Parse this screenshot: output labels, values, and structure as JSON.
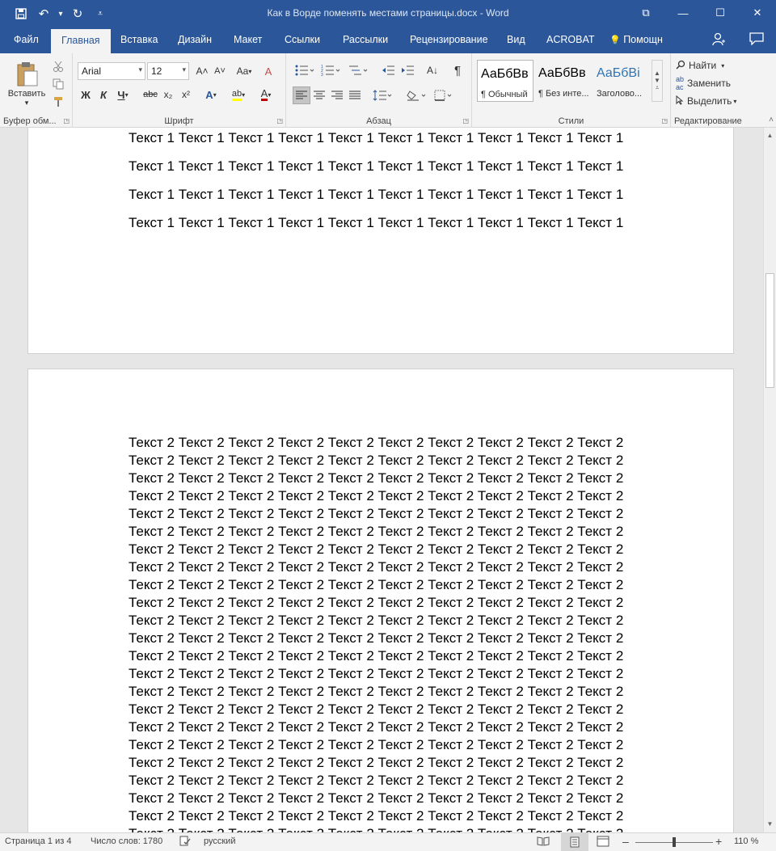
{
  "window": {
    "title": "Как в Ворде поменять местами страницы.docx - Word",
    "controls": {
      "ribbon_display": "⧉",
      "minimize": "—",
      "maximize": "☐",
      "close": "✕"
    }
  },
  "qat": {
    "save": "💾",
    "undo": "↶",
    "undo_dd": "▾",
    "redo": "↻",
    "customize": "⩡"
  },
  "tabs": [
    {
      "label": "Файл"
    },
    {
      "label": "Главная"
    },
    {
      "label": "Вставка"
    },
    {
      "label": "Дизайн"
    },
    {
      "label": "Макет"
    },
    {
      "label": "Ссылки"
    },
    {
      "label": "Рассылки"
    },
    {
      "label": "Рецензирование"
    },
    {
      "label": "Вид"
    },
    {
      "label": "ACROBAT"
    },
    {
      "label": "Помощн"
    }
  ],
  "tell_me_icon": "💡",
  "ribbon": {
    "clipboard": {
      "paste": "Вставить",
      "paste_dd": "▾",
      "group": "Буфер обм..."
    },
    "font": {
      "name": "Arial",
      "size": "12",
      "bold": "Ж",
      "italic": "К",
      "underline": "Ч",
      "strike": "abc",
      "subscript": "x₂",
      "superscript": "x²",
      "grow": "A˄",
      "shrink": "A˅",
      "case": "Aa",
      "clear": "A",
      "effects": "A",
      "highlight": "ab",
      "color": "A",
      "group": "Шрифт"
    },
    "paragraph": {
      "group": "Абзац",
      "pilcrow": "¶",
      "sort": "A↓"
    },
    "styles": {
      "items": [
        {
          "sample": "АаБбВв",
          "name": "¶ Обычный"
        },
        {
          "sample": "АаБбВв",
          "name": "¶ Без инте..."
        },
        {
          "sample": "АаБбВі",
          "name": "Заголово..."
        }
      ],
      "group": "Стили"
    },
    "editing": {
      "find": "Найти",
      "replace": "Заменить",
      "select": "Выделить",
      "group": "Редактирование"
    }
  },
  "document": {
    "page1_line": "Текст 1 Текст 1 Текст 1 Текст 1 Текст 1 Текст 1 Текст 1 Текст 1 Текст 1 Текст 1",
    "page2_line": "Текст 2 Текст 2 Текст 2 Текст 2 Текст 2 Текст 2 Текст 2 Текст 2 Текст 2 Текст 2"
  },
  "status": {
    "page": "Страница 1 из 4",
    "words": "Число слов: 1780",
    "language": "русский",
    "zoom_minus": "–",
    "zoom_plus": "+",
    "zoom": "110 %"
  },
  "colors": {
    "accent": "#2b579a",
    "ribbon_bg": "#f3f3f3",
    "doc_bg": "#e6e6e6"
  }
}
